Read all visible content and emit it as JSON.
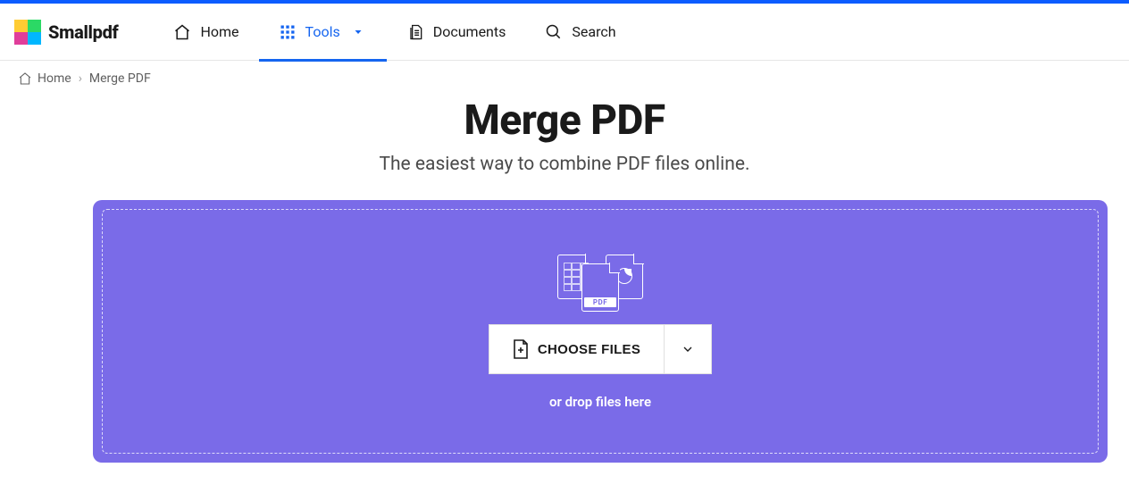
{
  "brand": {
    "name": "Smallpdf"
  },
  "nav": {
    "home": "Home",
    "tools": "Tools",
    "documents": "Documents",
    "search": "Search"
  },
  "breadcrumb": {
    "home": "Home",
    "separator": "›",
    "current": "Merge PDF"
  },
  "page": {
    "title": "Merge PDF",
    "subtitle": "The easiest way to combine PDF files online."
  },
  "dropzone": {
    "choose_label": "CHOOSE FILES",
    "drop_hint": "or drop files here",
    "pdf_badge": "PDF"
  }
}
